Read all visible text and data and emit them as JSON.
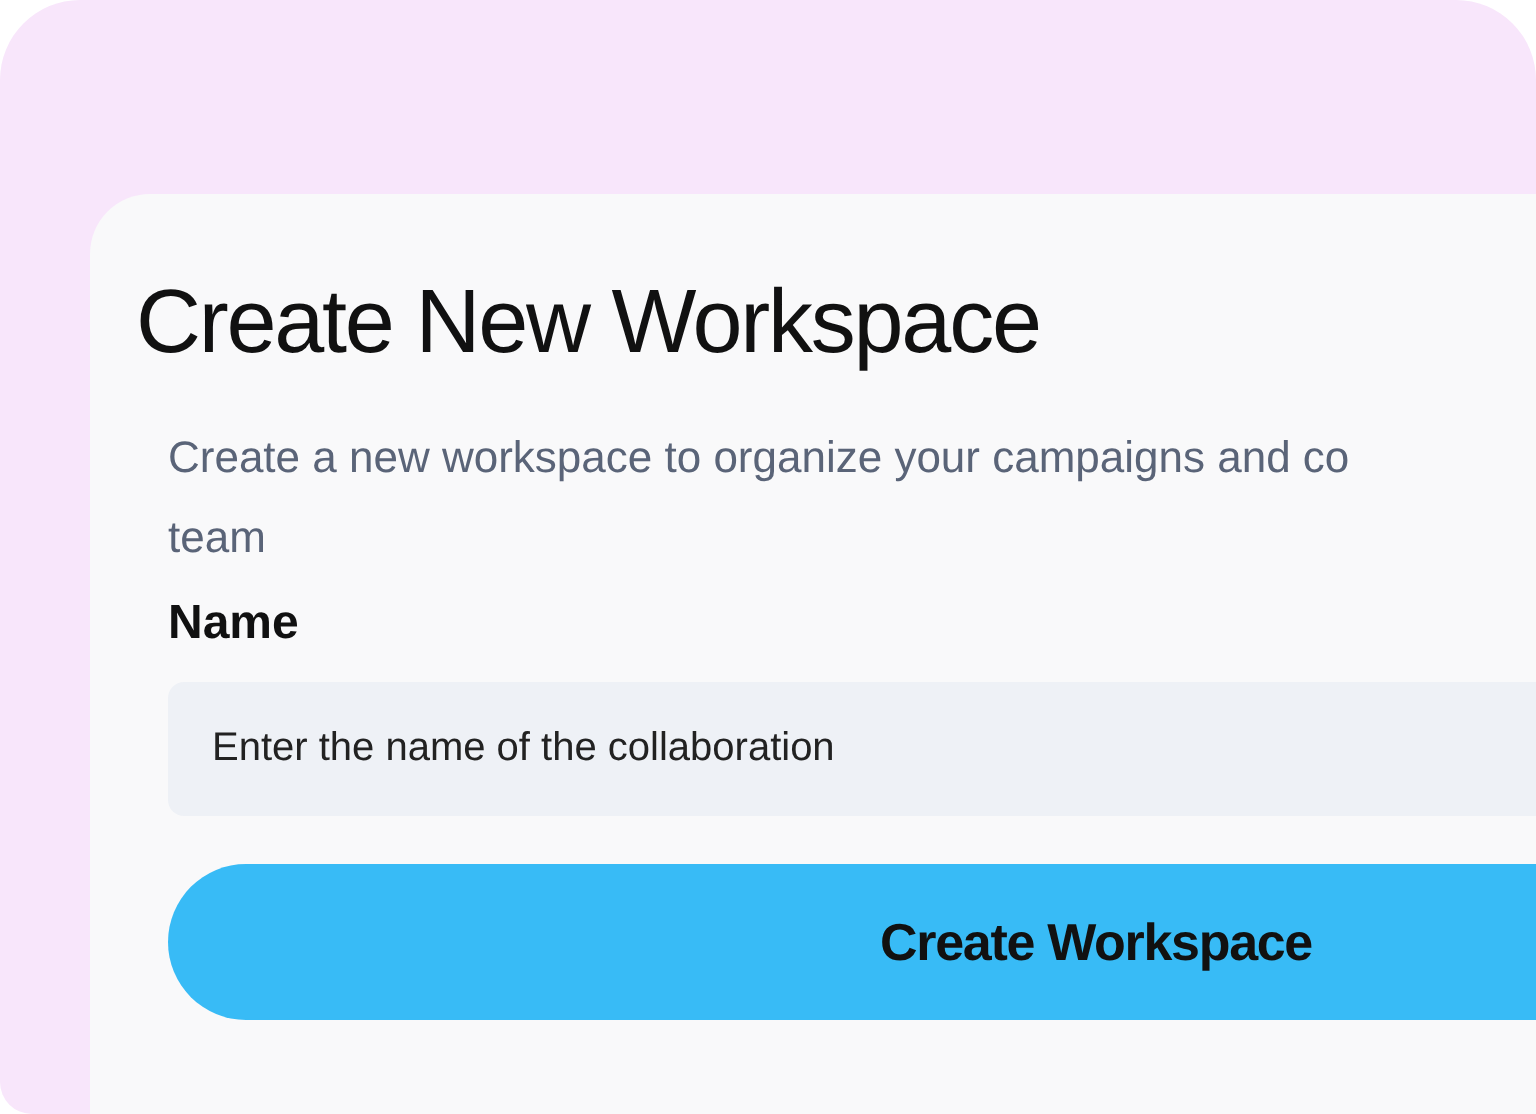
{
  "dialog": {
    "title": "Create New Workspace",
    "description_lines": [
      "Create a new workspace to organize your campaigns and co",
      "team"
    ],
    "name_field": {
      "label": "Name",
      "placeholder": "Enter the name of the collaboration"
    },
    "submit_button": "Create Workspace"
  }
}
